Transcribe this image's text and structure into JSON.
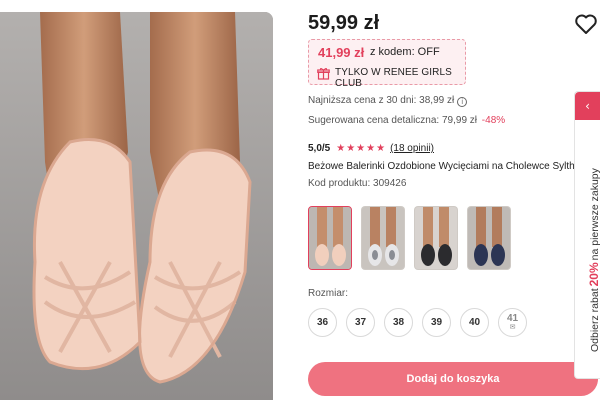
{
  "product": {
    "price": "59,99 zł",
    "promo_price": "41,99 zł",
    "promo_code_text": "z kodem: OFF",
    "promo_club_text": "TYLKO W RENEE GIRLS CLUB",
    "lowest_price_text": "Najniższa cena z 30 dni: 38,99 zł",
    "suggested_price_text": "Sugerowana cena detaliczna: 79,99 zł",
    "suggested_discount": "-48%",
    "rating_score": "5,0/5",
    "rating_stars": 5,
    "rating_stars_text": "★★★★★",
    "reviews_text": "(18 opinii)",
    "name": "Beżowe Balerinki Ozdobione Wycięciami na Cholewce Sylth",
    "code_text": "Kod produktu: 309426"
  },
  "thumbnails": [
    {
      "label": "beige-flats",
      "active": true
    },
    {
      "label": "silver-flats",
      "active": false
    },
    {
      "label": "black-flats",
      "active": false
    },
    {
      "label": "navy-flats",
      "active": false
    }
  ],
  "sizes": {
    "label": "Rozmiar:",
    "options": [
      {
        "value": "36",
        "available": true
      },
      {
        "value": "37",
        "available": true
      },
      {
        "value": "38",
        "available": true
      },
      {
        "value": "39",
        "available": true
      },
      {
        "value": "40",
        "available": true
      },
      {
        "value": "41",
        "available": false
      }
    ]
  },
  "cart_button": "Dodaj do koszyka",
  "side_promo": {
    "prefix": "Odbierz rabat",
    "percent": "20%",
    "suffix": "na pierwsze zakupy",
    "arrow": "‹"
  },
  "icons": {
    "wishlist": "heart-outline-icon",
    "gift": "gift-icon",
    "info": "info-icon",
    "notify": "mail-icon"
  },
  "colors": {
    "accent": "#e2405c",
    "button": "#ef7280",
    "promo_bg": "#fdf0f2"
  }
}
